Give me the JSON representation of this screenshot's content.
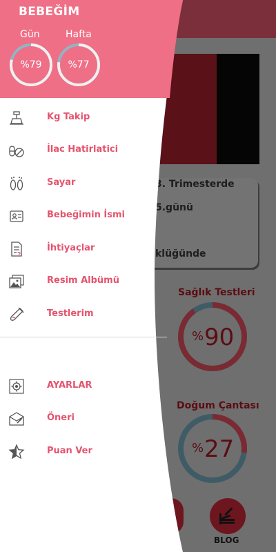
{
  "background": {
    "trimester_text": "3. Trimesterde",
    "day_text": "5.günü",
    "size_text": "klüğünde",
    "health_tests": {
      "title": "Sağlık Testleri",
      "symbol": "%",
      "value": "90",
      "progress": 0.9
    },
    "birth_bag": {
      "title": "Doğum Çantası",
      "symbol": "%",
      "value": "27",
      "progress": 0.27
    },
    "blog_label": "BLOG"
  },
  "drawer": {
    "title": "BEBEĞİM",
    "stats": [
      {
        "label": "Gün",
        "value": "%79",
        "progress": 0.79
      },
      {
        "label": "Hafta",
        "value": "%77",
        "progress": 0.77
      }
    ],
    "menu": [
      {
        "label": "Kg Takip",
        "icon": "scale-icon"
      },
      {
        "label": "İlac Hatirlatici",
        "icon": "pills-icon"
      },
      {
        "label": "Sayar",
        "icon": "footprints-icon"
      },
      {
        "label": "Bebeğimin İsmi",
        "icon": "id-card-icon"
      },
      {
        "label": "İhtiyaçlar",
        "icon": "checklist-icon"
      },
      {
        "label": "Resim Albümü",
        "icon": "photo-album-icon"
      },
      {
        "label": "Testlerim",
        "icon": "test-tube-icon"
      }
    ],
    "secondary_menu": [
      {
        "label": "AYARLAR",
        "icon": "settings-icon"
      },
      {
        "label": "Öneri",
        "icon": "envelope-icon"
      },
      {
        "label": "Puan Ver",
        "icon": "star-icon"
      }
    ]
  },
  "colors": {
    "accent": "#ef6f86",
    "label": "#e4546e",
    "ring_track": "#8fb6c4",
    "ring_progress": "#f0f0f0"
  }
}
